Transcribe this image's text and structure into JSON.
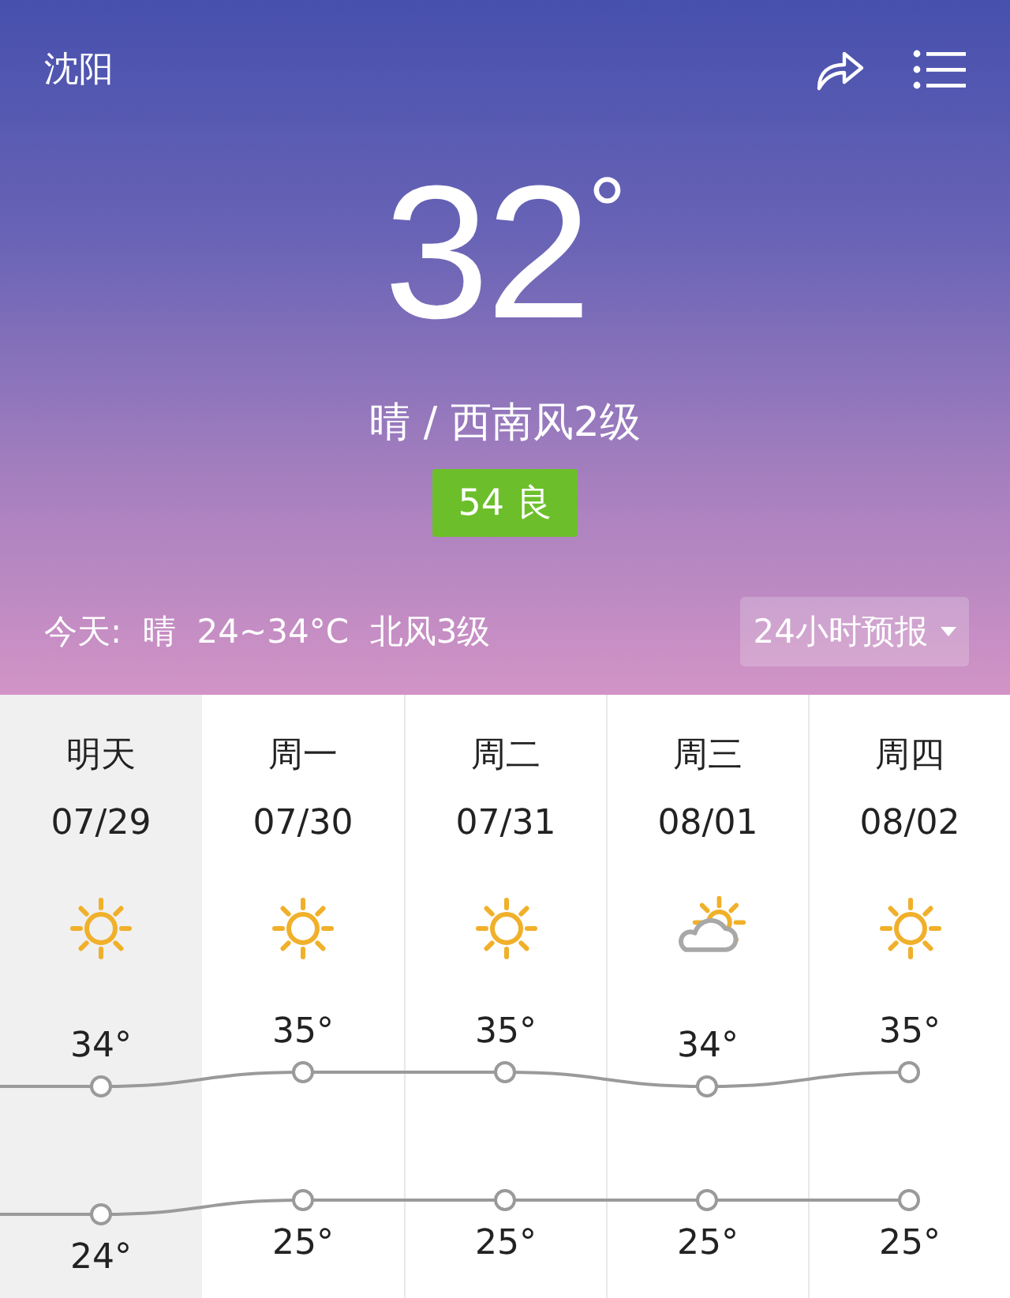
{
  "header": {
    "city": "沈阳",
    "temperature": "32",
    "unit": "°",
    "condition": "晴 / 西南风2级",
    "aqi": "54 良",
    "today": "今天:  晴  24~34°C  北风3级",
    "forecast_button": "24小时预报"
  },
  "days": [
    {
      "day": "明天",
      "date": "07/29",
      "kind": "sunny",
      "high": "34°",
      "low": "24°",
      "selected": true
    },
    {
      "day": "周一",
      "date": "07/30",
      "kind": "sunny",
      "high": "35°",
      "low": "25°",
      "selected": false
    },
    {
      "day": "周二",
      "date": "07/31",
      "kind": "sunny",
      "high": "35°",
      "low": "25°",
      "selected": false
    },
    {
      "day": "周三",
      "date": "08/01",
      "kind": "partly-cloudy",
      "high": "34°",
      "low": "25°",
      "selected": false
    },
    {
      "day": "周四",
      "date": "08/02",
      "kind": "sunny",
      "high": "35°",
      "low": "25°",
      "selected": false
    }
  ]
}
